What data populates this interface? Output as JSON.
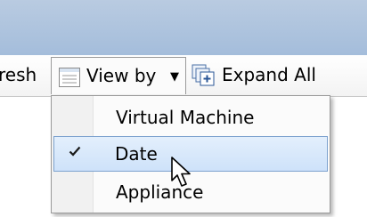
{
  "toolbar": {
    "refresh_label": "resh",
    "view_by_label": "View by",
    "view_by_arrow": "▼",
    "expand_all_label": "Expand All"
  },
  "view_by_menu": {
    "items": [
      {
        "label": "Virtual Machine",
        "checked": false
      },
      {
        "label": "Date",
        "checked": true
      },
      {
        "label": "Appliance",
        "checked": false
      }
    ]
  },
  "colors": {
    "titlebar": "#a4bddb",
    "highlight": "#cee2fa",
    "highlight_border": "#7da2ce"
  }
}
